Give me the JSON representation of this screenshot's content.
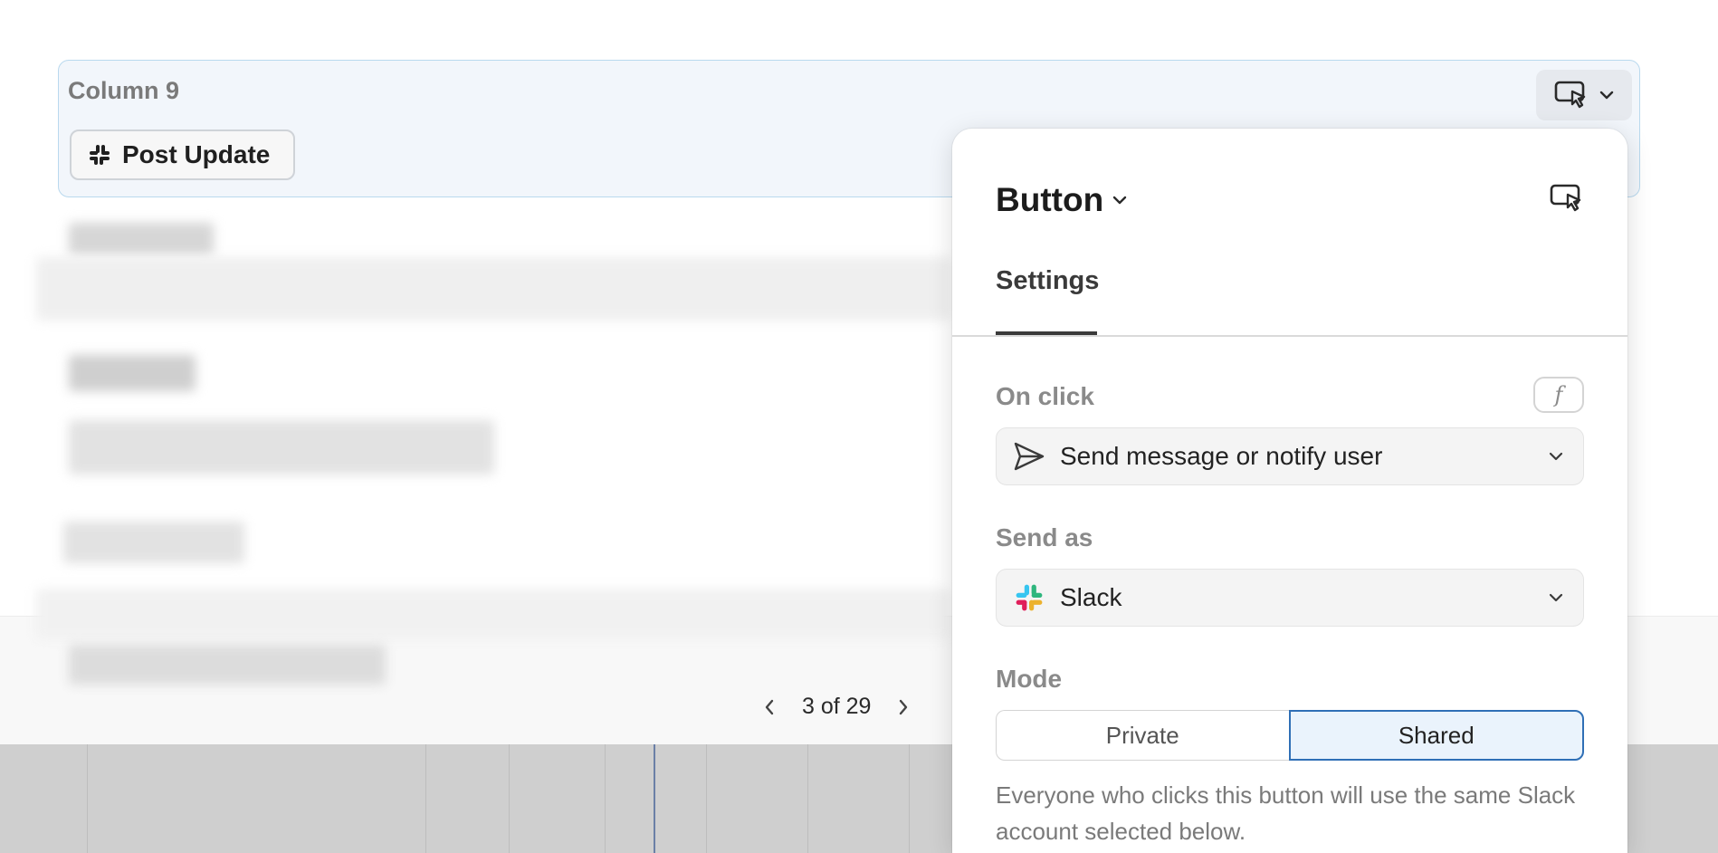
{
  "column": {
    "title": "Column 9",
    "button_label": "Post Update"
  },
  "pagination": {
    "current": "3 of 29"
  },
  "panel": {
    "title": "Button",
    "tabs": [
      {
        "label": "Settings",
        "active": true
      }
    ],
    "on_click": {
      "label": "On click",
      "fx_label": "f",
      "value": "Send message or notify user"
    },
    "send_as": {
      "label": "Send as",
      "value": "Slack"
    },
    "mode": {
      "label": "Mode",
      "options": [
        "Private",
        "Shared"
      ],
      "selected": "Shared"
    },
    "help_text": "Everyone who clicks this button will use the same Slack account selected below."
  },
  "colors": {
    "accent": "#2f6fb6",
    "selection_bg": "#f2f6fb",
    "selection_border": "#b9d9ee",
    "slack_green": "#2eb67d",
    "slack_blue": "#36c5f0",
    "slack_yellow": "#ecb22e",
    "slack_red": "#e01e5a"
  },
  "icons": {
    "column_type": "cursor-button-icon",
    "post_button": "slack-icon",
    "on_click": "send-icon",
    "send_as": "slack-icon",
    "dropdown": "chevron-down-icon"
  }
}
